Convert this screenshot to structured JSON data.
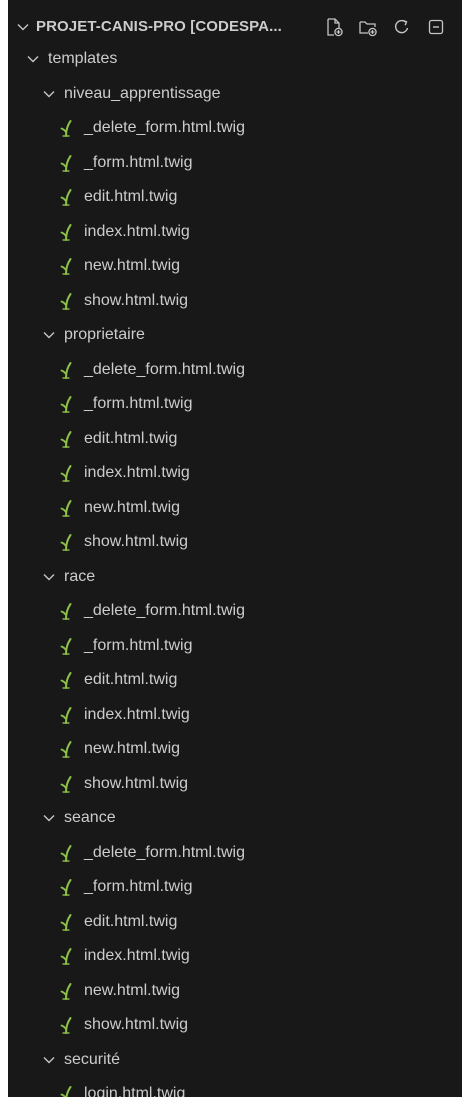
{
  "explorer": {
    "title": "PROJET-CANIS-PRO [CODESPA...",
    "actions": [
      {
        "icon": "new-file-icon"
      },
      {
        "icon": "new-folder-icon"
      },
      {
        "icon": "refresh-icon"
      },
      {
        "icon": "collapse-all-icon"
      }
    ]
  },
  "tree": {
    "root": {
      "label": "templates",
      "expanded": true
    },
    "folders": [
      {
        "label": "niveau_apprentissage",
        "expanded": true,
        "files": [
          "_delete_form.html.twig",
          "_form.html.twig",
          "edit.html.twig",
          "index.html.twig",
          "new.html.twig",
          "show.html.twig"
        ]
      },
      {
        "label": "proprietaire",
        "expanded": true,
        "files": [
          "_delete_form.html.twig",
          "_form.html.twig",
          "edit.html.twig",
          "index.html.twig",
          "new.html.twig",
          "show.html.twig"
        ]
      },
      {
        "label": "race",
        "expanded": true,
        "files": [
          "_delete_form.html.twig",
          "_form.html.twig",
          "edit.html.twig",
          "index.html.twig",
          "new.html.twig",
          "show.html.twig"
        ]
      },
      {
        "label": "seance",
        "expanded": true,
        "files": [
          "_delete_form.html.twig",
          "_form.html.twig",
          "edit.html.twig",
          "index.html.twig",
          "new.html.twig",
          "show.html.twig"
        ]
      },
      {
        "label": "securité",
        "expanded": true,
        "files": [
          "login.html.twig"
        ]
      }
    ]
  },
  "colors": {
    "panel_background": "#181818",
    "text": "#cccccc",
    "twig_icon": "#8dc149",
    "icon_gray": "#c5c5c5"
  }
}
